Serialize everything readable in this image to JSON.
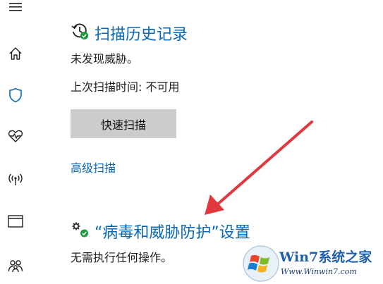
{
  "nav": {
    "items": [
      {
        "icon": "hamburger-menu-icon"
      },
      {
        "icon": "home-icon"
      },
      {
        "icon": "shield-icon"
      },
      {
        "icon": "heart-pulse-icon"
      },
      {
        "icon": "wifi-antenna-icon"
      },
      {
        "icon": "browser-window-icon"
      },
      {
        "icon": "family-icon"
      }
    ],
    "accent": "#0a67b3"
  },
  "scan_history": {
    "title": "扫描历史记录",
    "icon": "history-check-icon",
    "status": "未发现威胁。",
    "last_scan": "上次扫描时间: 不可用",
    "quick_scan_label": "快速扫描",
    "advanced_scan_label": "高级扫描"
  },
  "settings": {
    "title": "“病毒和威胁防护”设置",
    "icon": "gears-check-icon",
    "status": "无需执行任何操作。"
  },
  "watermark": {
    "line1": "Win7系统之家",
    "line2": "Www.Winwin7.com"
  },
  "colors": {
    "link": "#0a67b3",
    "button_bg": "#cccccc",
    "arrow": "#e0383e",
    "check": "#1a9b3a"
  }
}
